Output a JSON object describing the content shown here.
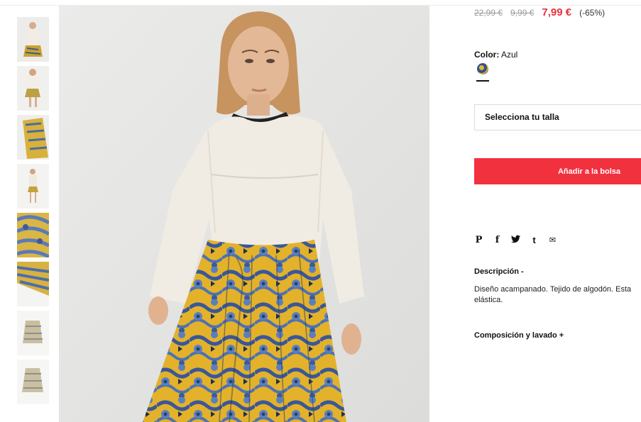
{
  "gallery": {
    "thumbnails": [
      {
        "alt": "thumb-1"
      },
      {
        "alt": "thumb-2"
      },
      {
        "alt": "thumb-3"
      },
      {
        "alt": "thumb-4"
      },
      {
        "alt": "thumb-5"
      },
      {
        "alt": "thumb-6"
      },
      {
        "alt": "thumb-7"
      },
      {
        "alt": "thumb-8"
      }
    ]
  },
  "product": {
    "price_original": "22,99 €",
    "price_previous": "9,99 €",
    "price_current": "7,99 €",
    "discount": "(-65%)",
    "color_label": "Color:",
    "color_value": "Azul",
    "size_placeholder": "Selecciona tu talla",
    "add_to_bag": "Añadir a la bolsa",
    "description_title": "Descripción  -",
    "description_text": "Diseño acampanado. Tejido de algodón. Esta elástica.",
    "composition_title": "Composición y lavado  +"
  },
  "social": {
    "pinterest": "P",
    "facebook": "f",
    "twitter": "t",
    "tumblr": "t",
    "email": "✉"
  },
  "colors": {
    "accent": "#f2313f",
    "price_sale": "#e8313c",
    "skirt_yellow": "#e7b52b",
    "skirt_blue": "#4a6fb0",
    "sweater": "#f1ece3"
  }
}
